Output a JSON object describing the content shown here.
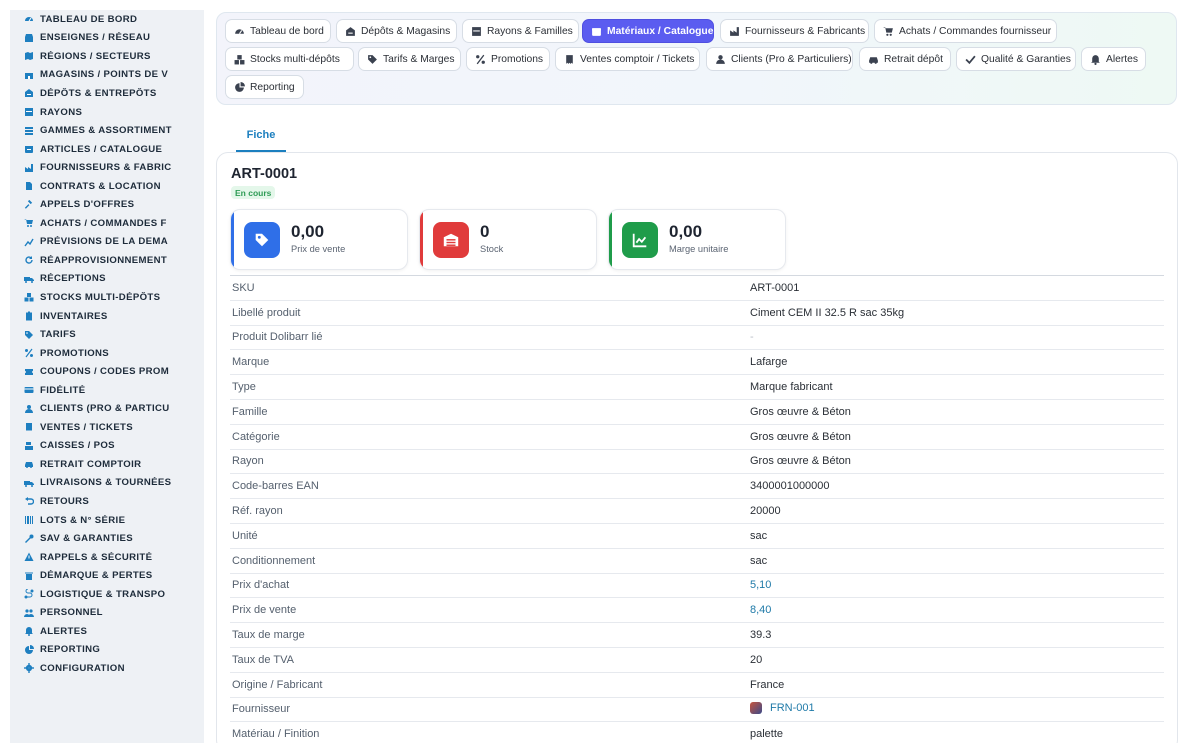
{
  "sidebar": {
    "items": [
      {
        "label": "TABLEAU DE BORD",
        "icon": "gauge-icon",
        "name": "sidebar-item-tableau-de-bord"
      },
      {
        "label": "ENSEIGNES / RÉSEAU",
        "icon": "store-icon",
        "name": "sidebar-item-enseignes"
      },
      {
        "label": "RÉGIONS / SECTEURS",
        "icon": "map-icon",
        "name": "sidebar-item-regions"
      },
      {
        "label": "MAGASINS / POINTS DE V",
        "icon": "shop-icon",
        "name": "sidebar-item-magasins"
      },
      {
        "label": "DÉPÔTS & ENTREPÔTS",
        "icon": "warehouse-icon",
        "name": "sidebar-item-depots"
      },
      {
        "label": "RAYONS",
        "icon": "shelf-icon",
        "name": "sidebar-item-rayons"
      },
      {
        "label": "GAMMES & ASSORTIMENT",
        "icon": "layers-icon",
        "name": "sidebar-item-gammes"
      },
      {
        "label": "ARTICLES / CATALOGUE",
        "icon": "box-icon",
        "name": "sidebar-item-articles"
      },
      {
        "label": "FOURNISSEURS & FABRIC",
        "icon": "factory-icon",
        "name": "sidebar-item-fournisseurs"
      },
      {
        "label": "CONTRATS & LOCATION",
        "icon": "document-icon",
        "name": "sidebar-item-contrats"
      },
      {
        "label": "APPELS D'OFFRES",
        "icon": "gavel-icon",
        "name": "sidebar-item-appels"
      },
      {
        "label": "ACHATS / COMMANDES F",
        "icon": "cart-icon",
        "name": "sidebar-item-achats"
      },
      {
        "label": "PRÉVISIONS DE LA DEMA",
        "icon": "chart-icon",
        "name": "sidebar-item-previsions"
      },
      {
        "label": "RÉAPPROVISIONNEMENT",
        "icon": "refresh-icon",
        "name": "sidebar-item-reappro"
      },
      {
        "label": "RÉCEPTIONS",
        "icon": "truck-icon",
        "name": "sidebar-item-receptions"
      },
      {
        "label": "STOCKS MULTI-DÉPÔTS",
        "icon": "cubes-icon",
        "name": "sidebar-item-stocks"
      },
      {
        "label": "INVENTAIRES",
        "icon": "clipboard-icon",
        "name": "sidebar-item-inventaires"
      },
      {
        "label": "TARIFS",
        "icon": "tag-icon",
        "name": "sidebar-item-tarifs"
      },
      {
        "label": "PROMOTIONS",
        "icon": "percent-icon",
        "name": "sidebar-item-promotions"
      },
      {
        "label": "COUPONS / CODES PROM",
        "icon": "ticket-icon",
        "name": "sidebar-item-coupons"
      },
      {
        "label": "FIDÉLITÉ",
        "icon": "card-icon",
        "name": "sidebar-item-fidelite"
      },
      {
        "label": "CLIENTS (PRO & PARTICU",
        "icon": "user-icon",
        "name": "sidebar-item-clients"
      },
      {
        "label": "VENTES / TICKETS",
        "icon": "receipt-icon",
        "name": "sidebar-item-ventes"
      },
      {
        "label": "CAISSES / POS",
        "icon": "cash-register-icon",
        "name": "sidebar-item-caisses"
      },
      {
        "label": "RETRAIT COMPTOIR",
        "icon": "car-icon",
        "name": "sidebar-item-retrait"
      },
      {
        "label": "LIVRAISONS & TOURNÉES",
        "icon": "delivery-icon",
        "name": "sidebar-item-livraisons"
      },
      {
        "label": "RETOURS",
        "icon": "undo-icon",
        "name": "sidebar-item-retours"
      },
      {
        "label": "LOTS & N° SÉRIE",
        "icon": "barcode-icon",
        "name": "sidebar-item-lots"
      },
      {
        "label": "SAV & GARANTIES",
        "icon": "tools-icon",
        "name": "sidebar-item-sav"
      },
      {
        "label": "RAPPELS & SÉCURITÉ",
        "icon": "warning-icon",
        "name": "sidebar-item-rappels"
      },
      {
        "label": "DÉMARQUE & PERTES",
        "icon": "trash-icon",
        "name": "sidebar-item-demarque"
      },
      {
        "label": "LOGISTIQUE & TRANSPO",
        "icon": "route-icon",
        "name": "sidebar-item-logistique"
      },
      {
        "label": "PERSONNEL",
        "icon": "users-icon",
        "name": "sidebar-item-personnel"
      },
      {
        "label": "ALERTES",
        "icon": "bell-icon",
        "name": "sidebar-item-alertes"
      },
      {
        "label": "REPORTING",
        "icon": "pie-icon",
        "name": "sidebar-item-reporting"
      },
      {
        "label": "CONFIGURATION",
        "icon": "gear-icon",
        "name": "sidebar-item-configuration"
      }
    ]
  },
  "tabs": [
    {
      "label": "Tableau de bord",
      "icon": "gauge-icon",
      "active": false
    },
    {
      "label": "Dépôts & Magasins",
      "icon": "warehouse-icon",
      "active": false
    },
    {
      "label": "Rayons & Familles",
      "icon": "shelf-icon",
      "active": false
    },
    {
      "label": "Matériaux / Catalogue",
      "icon": "box-icon",
      "active": true
    },
    {
      "label": "Fournisseurs & Fabricants",
      "icon": "factory-icon",
      "active": false
    },
    {
      "label": "Achats / Commandes fournisseur",
      "icon": "cart-icon",
      "active": false
    },
    {
      "label": "Stocks multi-dépôts",
      "icon": "cubes-icon",
      "active": false
    },
    {
      "label": "Tarifs & Marges",
      "icon": "tag-icon",
      "active": false
    },
    {
      "label": "Promotions",
      "icon": "percent-icon",
      "active": false
    },
    {
      "label": "Ventes comptoir / Tickets",
      "icon": "receipt-icon",
      "active": false
    },
    {
      "label": "Clients (Pro & Particuliers)",
      "icon": "user-icon",
      "active": false
    },
    {
      "label": "Retrait dépôt",
      "icon": "car-icon",
      "active": false
    },
    {
      "label": "Qualité & Garanties",
      "icon": "check-icon",
      "active": false
    },
    {
      "label": "Alertes",
      "icon": "bell-icon",
      "active": false
    },
    {
      "label": "Reporting",
      "icon": "pie-icon",
      "active": false
    }
  ],
  "content_tab": "Fiche",
  "record": {
    "ref": "ART-0001",
    "status": "En cours"
  },
  "kpis": [
    {
      "value": "0,00",
      "label": "Prix de vente",
      "icon": "tag-icon",
      "color": "#2f6fe8"
    },
    {
      "value": "0",
      "label": "Stock",
      "icon": "warehouse-icon",
      "color": "#e03b3b"
    },
    {
      "value": "0,00",
      "label": "Marge unitaire",
      "icon": "chart-line-icon",
      "color": "#1f9c4a"
    }
  ],
  "fields": [
    {
      "key": "SKU",
      "value": "ART-0001",
      "style": ""
    },
    {
      "key": "Libellé produit",
      "value": "Ciment CEM II 32.5 R sac 35kg",
      "style": ""
    },
    {
      "key": "Produit Dolibarr lié",
      "value": "-",
      "style": "muted"
    },
    {
      "key": "Marque",
      "value": "Lafarge",
      "style": ""
    },
    {
      "key": "Type",
      "value": "Marque fabricant",
      "style": ""
    },
    {
      "key": "Famille",
      "value": "Gros œuvre & Béton",
      "style": ""
    },
    {
      "key": "Catégorie",
      "value": "Gros œuvre & Béton",
      "style": ""
    },
    {
      "key": "Rayon",
      "value": "Gros œuvre & Béton",
      "style": ""
    },
    {
      "key": "Code-barres EAN",
      "value": "3400001000000",
      "style": ""
    },
    {
      "key": "Réf. rayon",
      "value": "20000",
      "style": ""
    },
    {
      "key": "Unité",
      "value": "sac",
      "style": ""
    },
    {
      "key": "Conditionnement",
      "value": "sac",
      "style": ""
    },
    {
      "key": "Prix d'achat",
      "value": "5,10",
      "style": "link"
    },
    {
      "key": "Prix de vente",
      "value": "8,40",
      "style": "link"
    },
    {
      "key": "Taux de marge",
      "value": "39.3",
      "style": ""
    },
    {
      "key": "Taux de TVA",
      "value": "20",
      "style": ""
    },
    {
      "key": "Origine / Fabricant",
      "value": "France",
      "style": ""
    },
    {
      "key": "Fournisseur",
      "value": "FRN-001",
      "style": "supplier"
    },
    {
      "key": "Matériau / Finition",
      "value": "palette",
      "style": ""
    }
  ],
  "colors": {
    "accent": "#5b5cf0",
    "link": "#1f7aa8",
    "status_bg": "#e4f7ea",
    "status_text": "#2e9b55"
  }
}
